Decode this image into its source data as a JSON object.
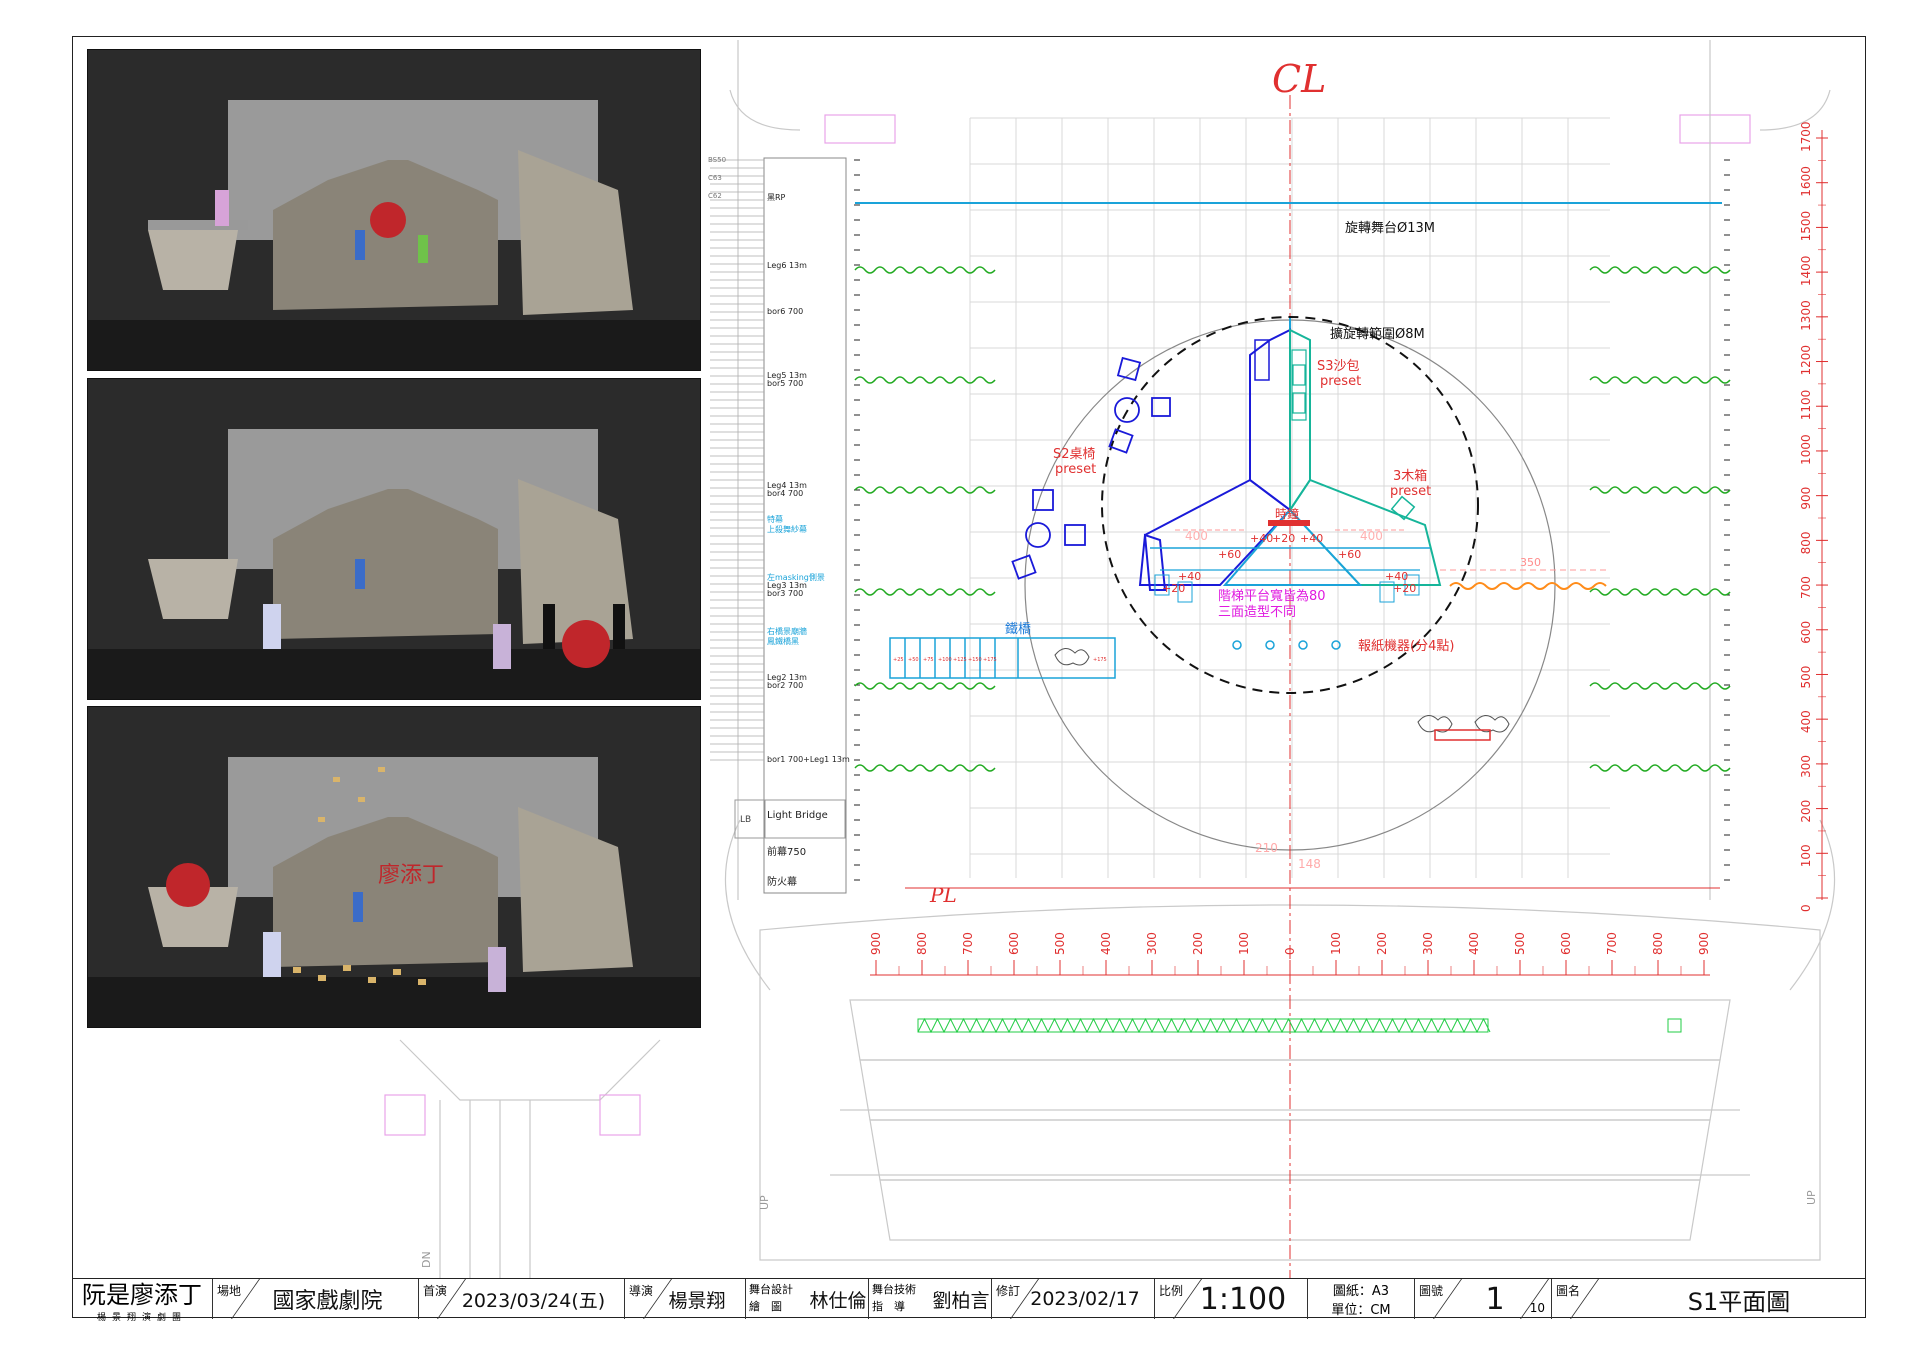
{
  "title_block": {
    "show_title": "阮是廖添丁",
    "company": "楊景翔演劇團",
    "venue_label": "場地",
    "venue": "國家戲劇院",
    "premiere_label": "首演",
    "premiere": "2023/03/24(五)",
    "director_label": "導演",
    "director": "楊景翔",
    "design_label_1": "舞台設計",
    "design_label_2": "繪　圖",
    "designer": "林仕倫",
    "tech_label_1": "舞台技術",
    "tech_label_2": "指　導",
    "tech": "劉柏言",
    "revision_label": "修訂",
    "revision": "2023/02/17",
    "scale_label": "比例",
    "scale": "1:100",
    "paper": "圖紙：A3",
    "unit": "單位：CM",
    "sheet_no_label": "圖號",
    "sheet_no": "1",
    "sheet_total": "10",
    "drawing_name_label": "圖名",
    "drawing_name": "S1平面圖"
  },
  "plan": {
    "centerline": "CL",
    "plaster_line": "PL",
    "rotating_stage": "旋轉舞台Ø13M",
    "rotation_range": "擴旋轉範圍Ø8M",
    "sandbag": "S3沙包",
    "preset": "preset",
    "table_chairs": "S2桌椅",
    "wood_boxes": "3木箱",
    "clock": "時鐘",
    "stair_note_1": "階梯平台寬皆為80",
    "stair_note_2": "三面造型不同",
    "newspaper": "報紙機器(分4點)",
    "bridge": "鐵橋",
    "heights": [
      "+40",
      "+20",
      "+40",
      "+60",
      "+60",
      "+40",
      "+20",
      "+40",
      "+20"
    ],
    "dim_400": "400",
    "dim_350": "350",
    "dim_210": "210",
    "dim_148": "148",
    "bridge_steps": [
      "+25",
      "+50",
      "+75",
      "+100",
      "+125",
      "+150",
      "+175"
    ],
    "bridge_end": "+175"
  },
  "batten_labels": [
    "黑RP",
    "Leg6 13m",
    "bor6 700",
    "Leg5 13m",
    "bor5 700",
    "Leg4 13m",
    "bor4 700",
    "特幕",
    "上殺舞紗幕",
    "左masking側景",
    "Leg3 13m",
    "bor3 700",
    "右橋景廟牆",
    "鳳鐵橋黑",
    "Leg2 13m",
    "bor2 700",
    "bor1 700+Leg1 13m",
    "Light Bridge",
    "前幕750",
    "防火幕"
  ],
  "pipe_ids_top": [
    "BS50",
    "C63",
    "C62"
  ],
  "depth_scale": [
    "1700",
    "1600",
    "1500",
    "1400",
    "1300",
    "1200",
    "1100",
    "1000",
    "900",
    "800",
    "700",
    "600",
    "500",
    "400",
    "300",
    "200",
    "100",
    "0"
  ],
  "width_scale_left": [
    "900",
    "800",
    "700",
    "600",
    "500",
    "400",
    "300",
    "200",
    "100"
  ],
  "width_scale_zero": "0",
  "width_scale_right": [
    "100",
    "200",
    "300",
    "400",
    "500",
    "600",
    "700",
    "800",
    "900"
  ],
  "lb_mark": "LB",
  "up_label": "UP",
  "dn_label": "DN",
  "render_text": "廖添丁"
}
